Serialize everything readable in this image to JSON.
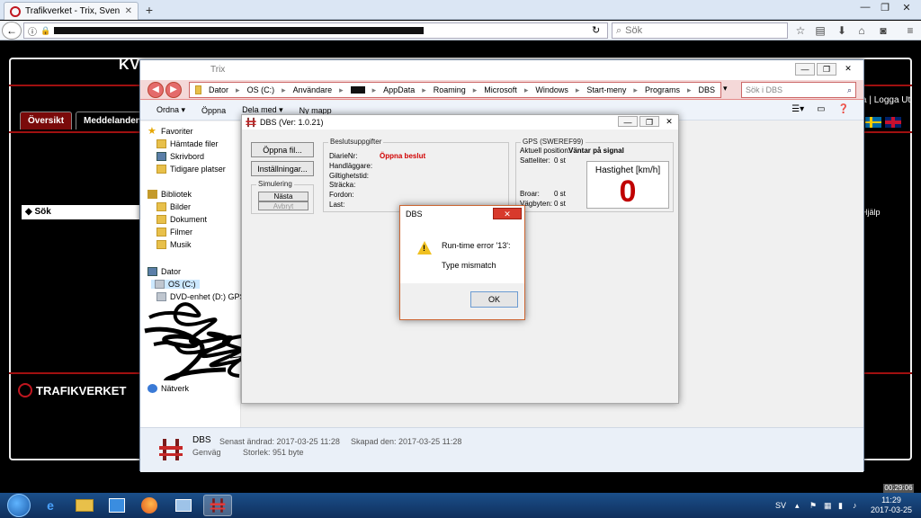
{
  "browser": {
    "tab_title": "Trafikverket - Trix, Sven Jin...",
    "search_placeholder": "Sök"
  },
  "webpage": {
    "logo_top": "KVERKET",
    "tab_overview": "Översikt",
    "tab_messages": "Meddelanden",
    "search_label": "◆ Sök",
    "footer_logo": "TRAFIKVERKET",
    "logout": "a | Logga Ut",
    "help": "Hjälp"
  },
  "explorer": {
    "title": "Trix",
    "path": [
      "Dator",
      "OS (C:)",
      "Användare",
      "AppData",
      "Roaming",
      "Microsoft",
      "Windows",
      "Start-meny",
      "Programs",
      "DBS"
    ],
    "search_placeholder": "Sök i DBS",
    "toolbar": [
      "Ordna ▾",
      "Öppna",
      "Dela med ▾",
      "Ny mapp"
    ],
    "nav": {
      "favorites": "Favoriter",
      "downloads": "Hämtade filer",
      "desktop": "Skrivbord",
      "recent": "Tidigare platser",
      "libraries": "Bibliotek",
      "pictures": "Bilder",
      "documents": "Dokument",
      "videos": "Filmer",
      "music": "Musik",
      "computer": "Dator",
      "os_drive": "OS (C:)",
      "dvd_drive": "DVD-enhet (D:) GPS",
      "network": "Nätverk"
    },
    "details": {
      "name": "DBS",
      "type": "Genväg",
      "modified": "Senast ändrad: 2017-03-25 11:28",
      "created": "Skapad den: 2017-03-25 11:28",
      "size": "Storlek: 951 byte"
    }
  },
  "dbs": {
    "title": "DBS (Ver: 1.0.21)",
    "open_file": "Öppna fil...",
    "settings": "Inställningar...",
    "simulation": {
      "legend": "Simulering",
      "next": "Nästa",
      "cancel": "Avbryt"
    },
    "decision": {
      "legend": "Beslutsuppgifter",
      "diarie_label": "DiarieNr:",
      "diarie_value": "Öppna beslut",
      "handler": "Handläggare:",
      "validity": "Giltighetstid:",
      "stretch": "Sträcka:",
      "vehicle": "Fordon:",
      "load": "Last:"
    },
    "gps": {
      "legend": "GPS (SWEREF99)",
      "position_label": "Aktuell position:",
      "position_value": "Väntar på signal",
      "satellites_label": "Satteliter:",
      "satellites_value": "0 st",
      "speed_label": "Hastighet [km/h]",
      "speed_value": "0",
      "bridges_label": "Broar:",
      "bridges_value": "0 st",
      "roadworks_label": "Vägbyten:",
      "roadworks_value": "0 st"
    }
  },
  "error_dialog": {
    "title": "DBS",
    "message1": "Run-time error '13':",
    "message2": "Type mismatch",
    "ok": "OK"
  },
  "taskbar": {
    "lang": "SV",
    "time": "11:29",
    "date": "2017-03-25",
    "timer": "00:29:06"
  }
}
